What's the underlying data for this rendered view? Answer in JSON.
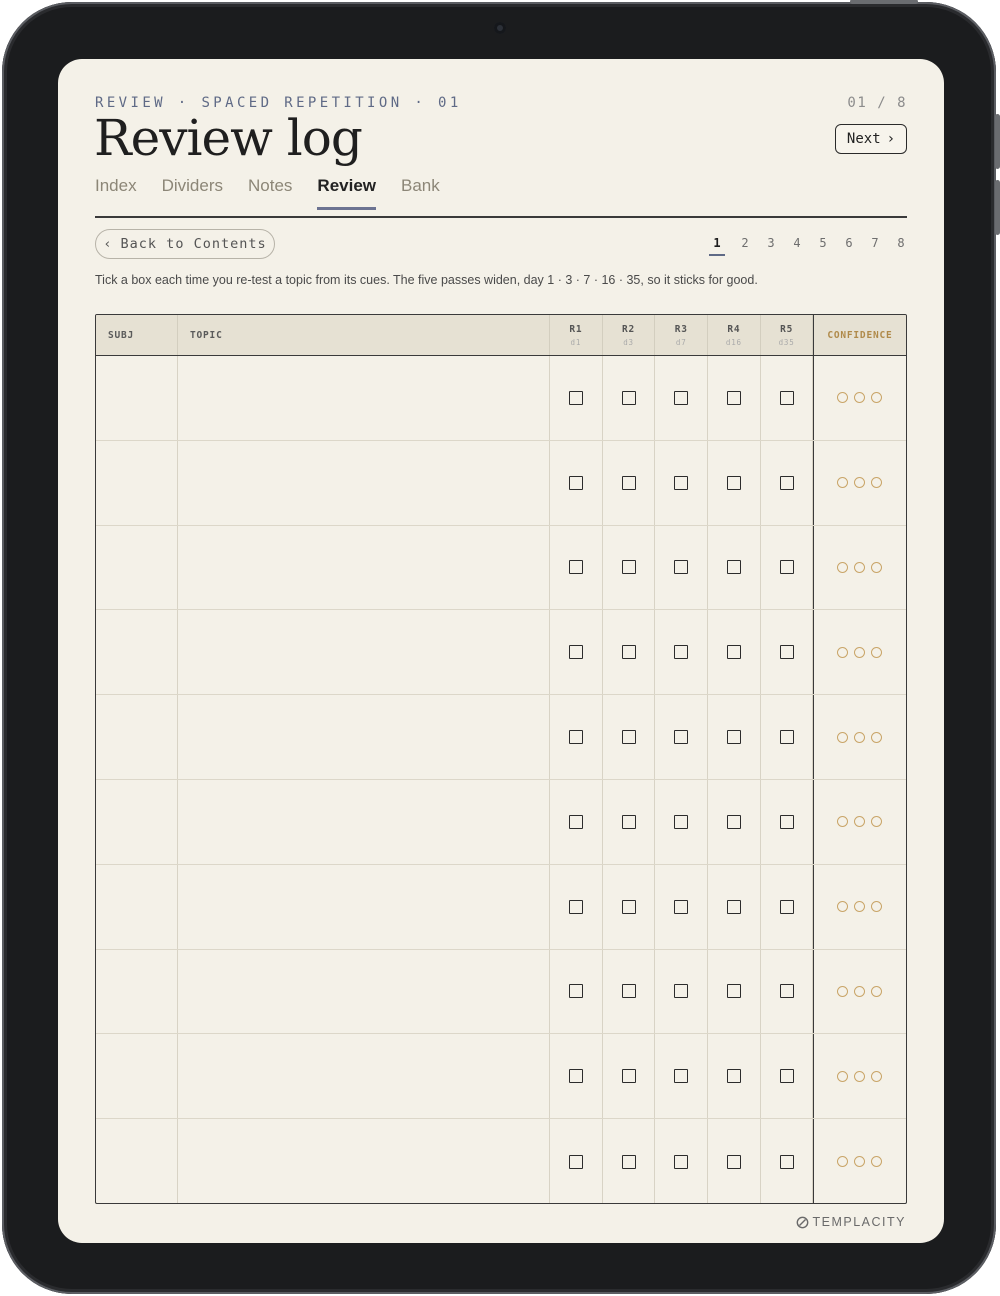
{
  "header": {
    "kicker": "REVIEW · SPACED REPETITION · 01",
    "pager": "01 / 8",
    "title": "Review log",
    "next_label": "Next"
  },
  "tabs": [
    {
      "label": "Index",
      "active": false
    },
    {
      "label": "Dividers",
      "active": false
    },
    {
      "label": "Notes",
      "active": false
    },
    {
      "label": "Review",
      "active": true
    },
    {
      "label": "Bank",
      "active": false
    }
  ],
  "back_button": {
    "label": "Back to Contents"
  },
  "page_numbers": [
    "1",
    "2",
    "3",
    "4",
    "5",
    "6",
    "7",
    "8"
  ],
  "active_page": "1",
  "instructions": "Tick a box each time you re-test a topic from its cues. The five passes widen, day 1 · 3 · 7 · 16 · 35, so it sticks for good.",
  "table": {
    "col_subj": "SUBJ",
    "col_topic": "TOPIC",
    "rounds": [
      {
        "label": "R1",
        "day": "d1"
      },
      {
        "label": "R2",
        "day": "d3"
      },
      {
        "label": "R3",
        "day": "d7"
      },
      {
        "label": "R4",
        "day": "d16"
      },
      {
        "label": "R5",
        "day": "d35"
      }
    ],
    "col_confidence": "CONFIDENCE",
    "row_count": 10,
    "confidence_levels": 3
  },
  "brand": "TEMPLACITY",
  "colors": {
    "accent": "#5f6a86",
    "confidence": "#c9a568",
    "paper": "#f4f1e8"
  }
}
